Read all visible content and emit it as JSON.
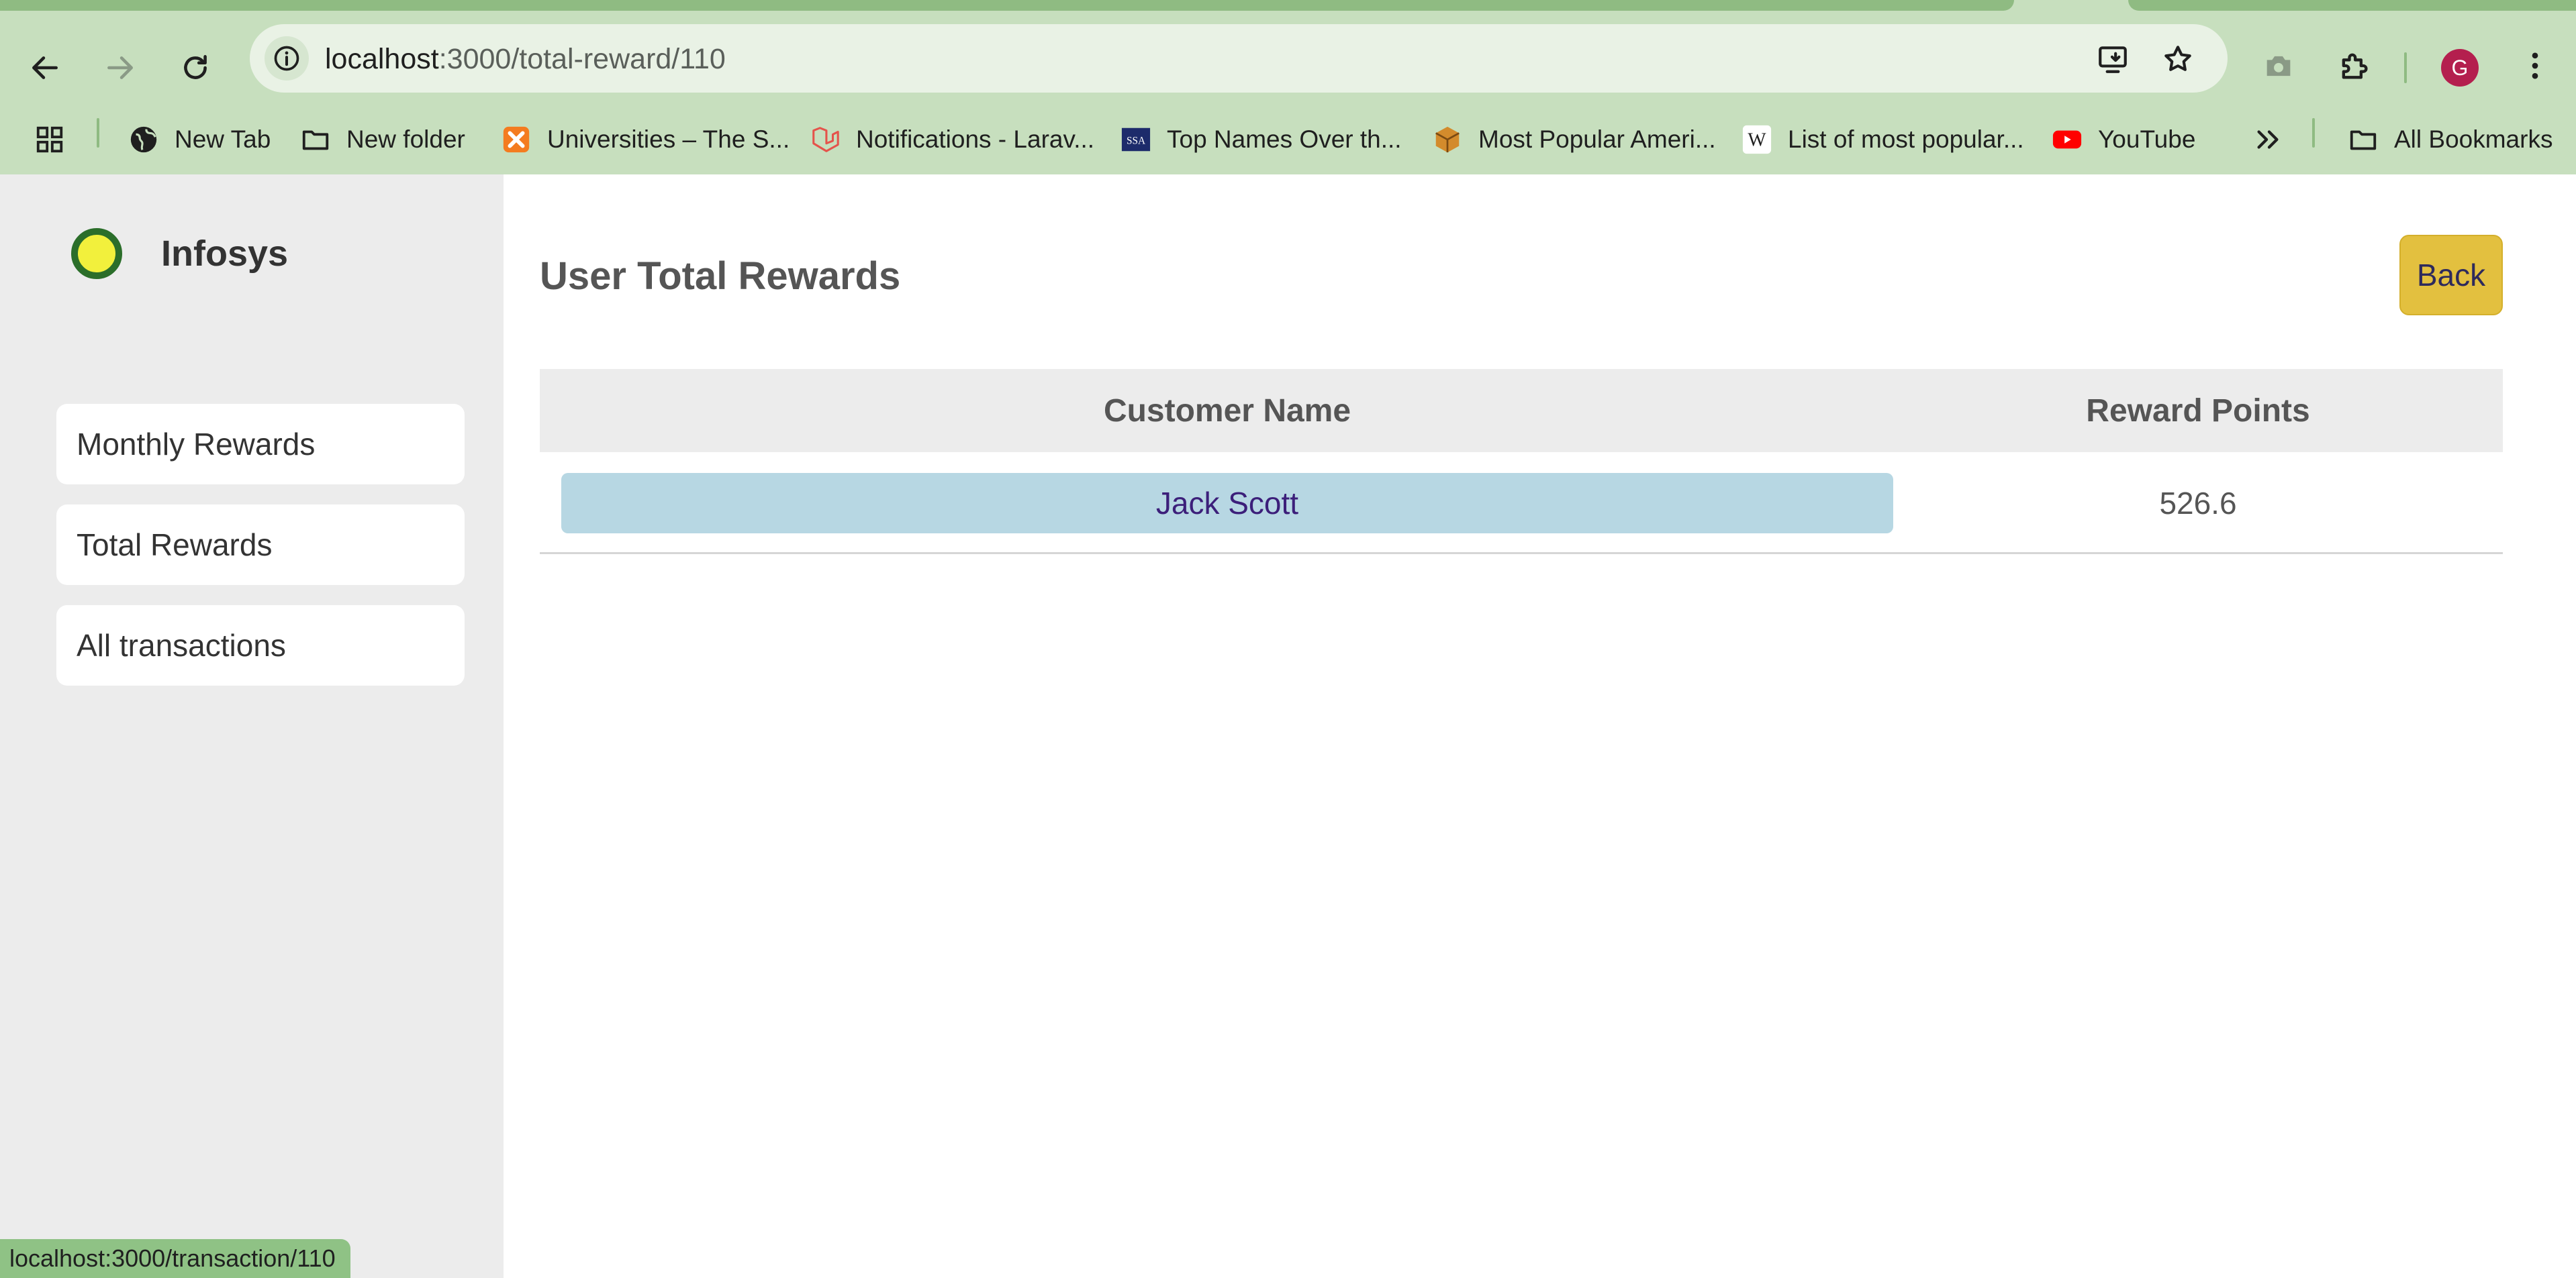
{
  "browser": {
    "url_host": "localhost",
    "url_path": ":3000/total-reward/110",
    "profile_initial": "G",
    "bookmarks": [
      {
        "label": "New Tab",
        "icon": "globe-icon"
      },
      {
        "label": "New folder",
        "icon": "folder-icon"
      },
      {
        "label": "Universities – The S...",
        "icon": "xampp-icon"
      },
      {
        "label": "Notifications - Larav...",
        "icon": "laravel-icon"
      },
      {
        "label": "Top Names Over th...",
        "icon": "ssa-icon"
      },
      {
        "label": "Most Popular Ameri...",
        "icon": "box-icon"
      },
      {
        "label": "List of most popular...",
        "icon": "wikipedia-icon"
      },
      {
        "label": "YouTube",
        "icon": "youtube-icon"
      }
    ],
    "all_bookmarks_label": "All Bookmarks",
    "status_url": "localhost:3000/transaction/110"
  },
  "sidebar": {
    "brand": "Infosys",
    "items": [
      {
        "label": "Monthly Rewards"
      },
      {
        "label": "Total Rewards"
      },
      {
        "label": "All transactions"
      }
    ]
  },
  "main": {
    "title": "User Total Rewards",
    "back_label": "Back",
    "table": {
      "headers": [
        "Customer Name",
        "Reward Points"
      ],
      "rows": [
        {
          "name": "Jack Scott",
          "points": "526.6"
        }
      ]
    }
  },
  "colors": {
    "chrome_bg": "#c7dfbe",
    "sidebar_bg": "#ececec",
    "back_button": "#e3c03f",
    "name_cell": "#b7d7e3",
    "logo_fill": "#f2f03c",
    "logo_ring": "#2b6e2a"
  }
}
